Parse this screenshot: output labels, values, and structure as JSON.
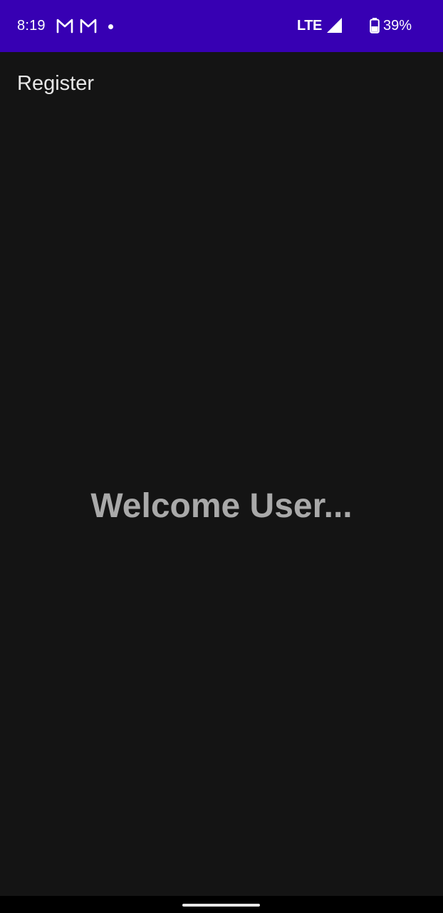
{
  "status_bar": {
    "time": "8:19",
    "notifications": [
      "gmail-icon",
      "gmail-icon",
      "more-notifications-dot"
    ],
    "network": "LTE",
    "signal_icon": "cell-signal-icon",
    "battery_icon": "battery-icon",
    "battery_percent": "39%",
    "background_color": "#3700b3"
  },
  "app_bar": {
    "title": "Register"
  },
  "main": {
    "welcome_text": "Welcome User..."
  },
  "navigation": {
    "gesture_handle_icon": "gesture-handle"
  },
  "colors": {
    "background": "#141414",
    "title_text": "#e6e6e6",
    "welcome_text": "#a9a9a9"
  }
}
